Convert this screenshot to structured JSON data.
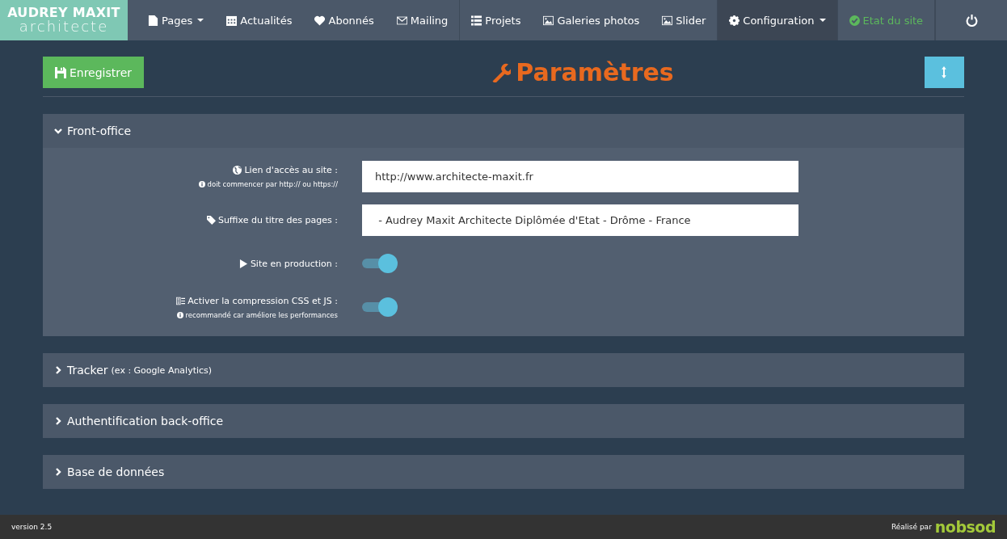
{
  "brand": {
    "name": "AUDREY MAXIT",
    "subtitle": "architecte"
  },
  "nav": [
    {
      "label": "Pages",
      "dropdown": true,
      "selected": false
    },
    {
      "label": "Actualités",
      "dropdown": false,
      "selected": false
    },
    {
      "label": "Abonnés",
      "dropdown": false,
      "selected": false
    },
    {
      "label": "Mailing",
      "dropdown": false,
      "selected": false
    },
    {
      "label": "Projets",
      "dropdown": false,
      "selected": false
    },
    {
      "label": "Galeries photos",
      "dropdown": false,
      "selected": false
    },
    {
      "label": "Slider",
      "dropdown": false,
      "selected": false
    },
    {
      "label": "Configuration",
      "dropdown": true,
      "selected": true
    },
    {
      "label": "Etat du site",
      "dropdown": false,
      "selected": false,
      "color": "#5cb85c"
    }
  ],
  "save_button": "Enregistrer",
  "page_title": "Paramètres",
  "sections": [
    {
      "title": "Front-office",
      "expanded": true,
      "fields": [
        {
          "kind": "text",
          "label": "Lien d'accès au site :",
          "hint": "doit commencer par http:// ou https://",
          "value": "http://www.architecte-maxit.fr"
        },
        {
          "kind": "text",
          "label": "Suffixe du titre des pages :",
          "value": " - Audrey Maxit Architecte Diplômée d'Etat - Drôme - France"
        },
        {
          "kind": "toggle",
          "label": "Site en production :",
          "on": true
        },
        {
          "kind": "toggle",
          "label": "Activer la compression CSS et JS :",
          "hint": "recommandé car améliore les performances",
          "on": true
        }
      ]
    },
    {
      "title": "Tracker",
      "note": "(ex : Google Analytics)",
      "expanded": false
    },
    {
      "title": "Authentification back-office",
      "expanded": false
    },
    {
      "title": "Base de données",
      "expanded": false
    }
  ],
  "footer": {
    "version": "version 2.5",
    "credit": "Réalisé par",
    "logo": "nobsod"
  }
}
